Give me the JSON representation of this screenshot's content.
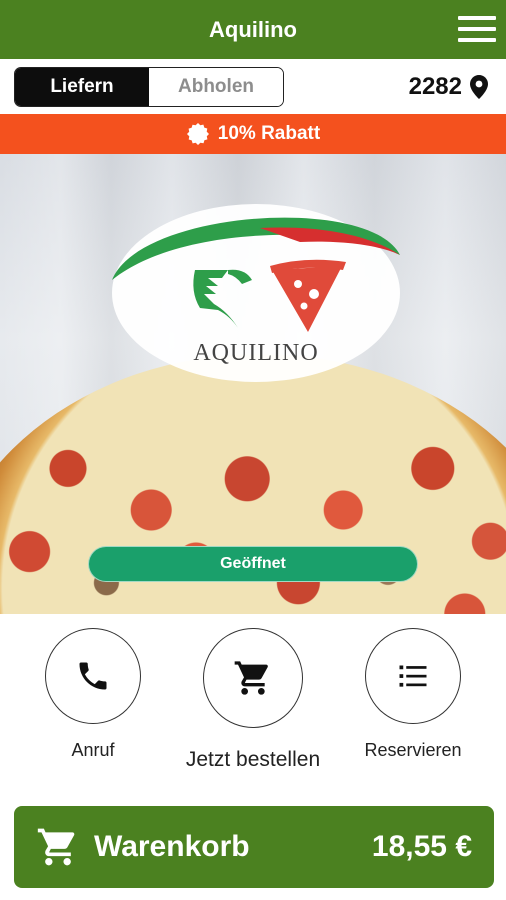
{
  "app": {
    "title": "Aquilino",
    "menu_icon": "hamburger-menu-icon"
  },
  "colors": {
    "primary_green": "#4b8120",
    "discount_orange": "#f4511e",
    "status_green": "#1aa06b"
  },
  "order_mode": {
    "options": [
      "Liefern",
      "Abholen"
    ],
    "selected": "Liefern"
  },
  "location": {
    "postal_code": "2282",
    "icon": "location-pin-icon"
  },
  "promo": {
    "text": "10% Rabatt",
    "icon": "discount-badge-icon"
  },
  "hero": {
    "logo_text": "AQUILINO",
    "status_label": "Geöffnet"
  },
  "actions": [
    {
      "label": "Anruf",
      "icon": "phone-icon"
    },
    {
      "label": "Jetzt bestellen",
      "icon": "cart-icon"
    },
    {
      "label": "Reservieren",
      "icon": "list-icon"
    }
  ],
  "cart": {
    "label": "Warenkorb",
    "total": "18,55 €",
    "icon": "cart-icon"
  }
}
